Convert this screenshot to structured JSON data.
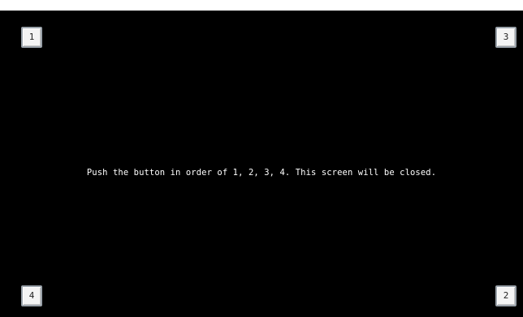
{
  "screen": {
    "instruction": "Push the button in order of 1, 2, 3, 4. This screen will be closed."
  },
  "buttons": {
    "top_left": "1",
    "top_right": "3",
    "bottom_left": "4",
    "bottom_right": "2"
  },
  "colors": {
    "screen_background": "#000000",
    "text": "#ffffff",
    "button_face": "#f4f4f4",
    "button_border": "#9aa2aa"
  }
}
